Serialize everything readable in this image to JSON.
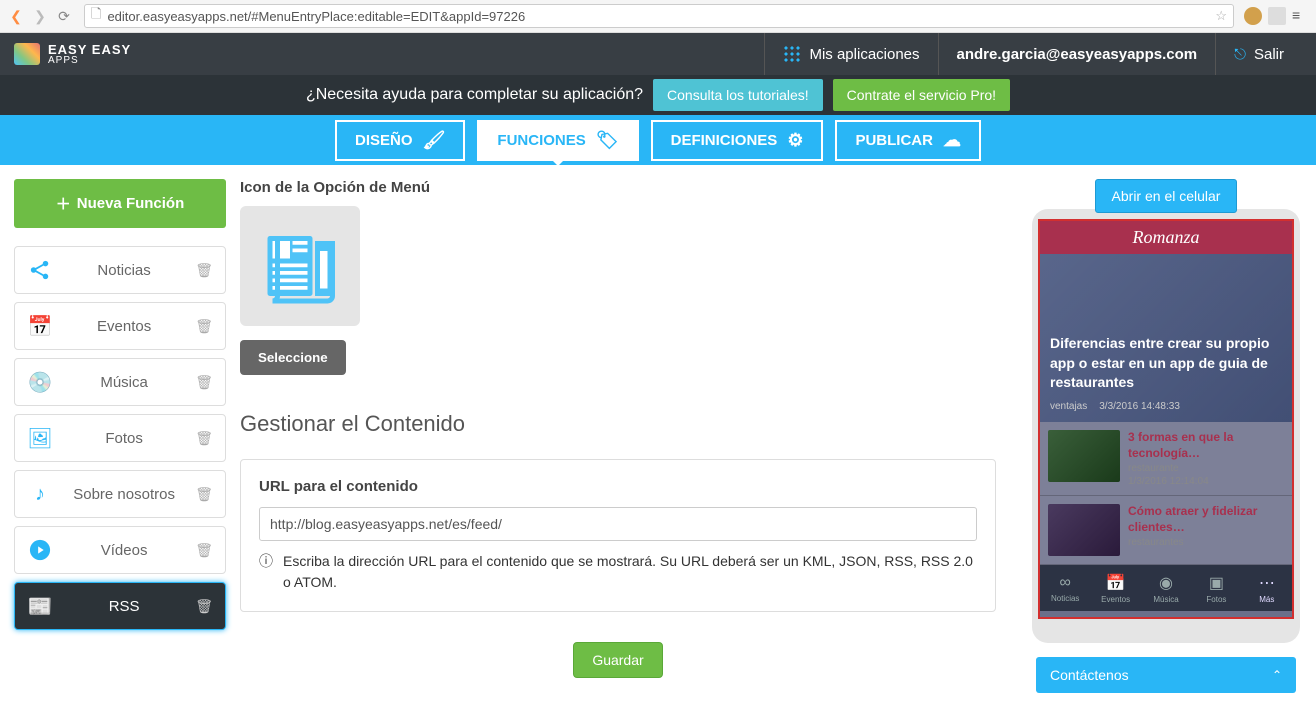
{
  "browser": {
    "url": "editor.easyeasyapps.net/#MenuEntryPlace:editable=EDIT&appId=97226"
  },
  "topbar": {
    "brand1": "EASY EASY",
    "brand2": "APPS",
    "myapps": "Mis aplicaciones",
    "email": "andre.garcia@easyeasyapps.com",
    "logout": "Salir"
  },
  "help": {
    "question": "¿Necesita ayuda para completar su aplicación?",
    "tutorials": "Consulta los tutoriales!",
    "pro": "Contrate el servicio Pro!"
  },
  "tabs": {
    "design": "DISEÑO",
    "functions": "FUNCIONES",
    "definitions": "DEFINICIONES",
    "publish": "PUBLICAR"
  },
  "sidebar": {
    "newfn": "Nueva Función",
    "items": [
      {
        "label": "Noticias"
      },
      {
        "label": "Eventos"
      },
      {
        "label": "Música"
      },
      {
        "label": "Fotos"
      },
      {
        "label": "Sobre nosotros"
      },
      {
        "label": "Vídeos"
      },
      {
        "label": "RSS"
      }
    ]
  },
  "content": {
    "icon_title": "Icon de la Opción de Menú",
    "select": "Seleccione",
    "manage": "Gestionar el Contenido",
    "url_label": "URL para el contenido",
    "url_value": "http://blog.easyeasyapps.net/es/feed/",
    "hint": "Escriba la dirección URL para el contenido que se mostrará. Su URL deberá ser un KML, JSON, RSS, RSS 2.0 o ATOM.",
    "save": "Guardar"
  },
  "preview": {
    "open": "Abrir en el celular",
    "app_name": "Romanza",
    "hero_title": "Diferencias entre crear su propio app o estar en un app de guia de restaurantes",
    "hero_tag": "ventajas",
    "hero_date": "3/3/2016 14:48:33",
    "news": [
      {
        "title": "3 formas en que la tecnología…",
        "tag": "restaurante",
        "date": "1/3/2016 12:14:04"
      },
      {
        "title": "Cómo atraer y fidelizar clientes…",
        "tag": "restaurantes",
        "date": ""
      }
    ],
    "nav": [
      {
        "label": "Noticias"
      },
      {
        "label": "Eventos"
      },
      {
        "label": "Música"
      },
      {
        "label": "Fotos"
      },
      {
        "label": "Más"
      }
    ],
    "contact": "Contáctenos"
  }
}
